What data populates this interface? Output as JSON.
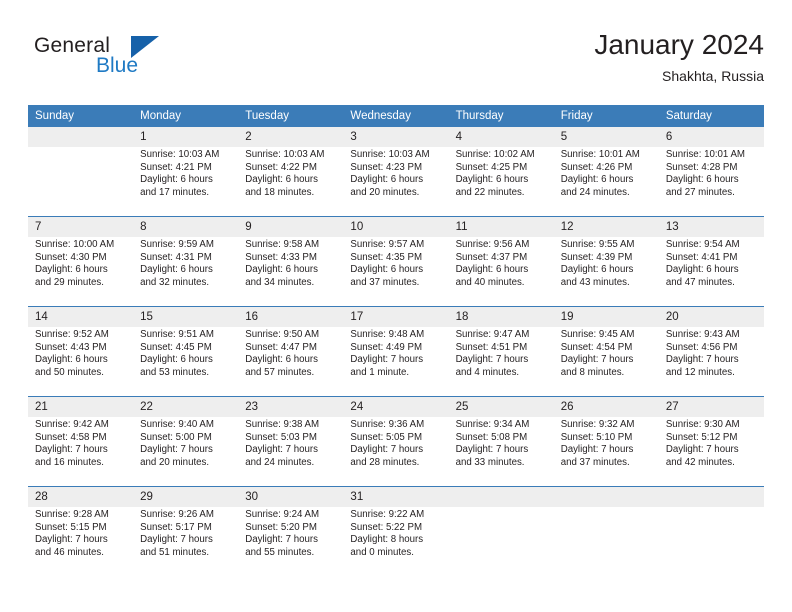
{
  "logo": {
    "word_top": "General",
    "word_bottom": "Blue",
    "triangle_color": "#1661a9",
    "blue_color": "#1f7ac4"
  },
  "header": {
    "title": "January 2024",
    "subtitle": "Shakhta, Russia",
    "header_bg": "#3b7cb8",
    "daynum_bg": "#eeeeee"
  },
  "weekday_headers": [
    "Sunday",
    "Monday",
    "Tuesday",
    "Wednesday",
    "Thursday",
    "Friday",
    "Saturday"
  ],
  "labels": {
    "sunrise": "Sunrise:",
    "sunset": "Sunset:",
    "daylight": "Daylight:"
  },
  "weeks": [
    [
      {
        "day": "",
        "sunrise": "",
        "sunset": "",
        "daylight1": "",
        "daylight2": ""
      },
      {
        "day": "1",
        "sunrise": "Sunrise: 10:03 AM",
        "sunset": "Sunset: 4:21 PM",
        "daylight1": "Daylight: 6 hours",
        "daylight2": "and 17 minutes."
      },
      {
        "day": "2",
        "sunrise": "Sunrise: 10:03 AM",
        "sunset": "Sunset: 4:22 PM",
        "daylight1": "Daylight: 6 hours",
        "daylight2": "and 18 minutes."
      },
      {
        "day": "3",
        "sunrise": "Sunrise: 10:03 AM",
        "sunset": "Sunset: 4:23 PM",
        "daylight1": "Daylight: 6 hours",
        "daylight2": "and 20 minutes."
      },
      {
        "day": "4",
        "sunrise": "Sunrise: 10:02 AM",
        "sunset": "Sunset: 4:25 PM",
        "daylight1": "Daylight: 6 hours",
        "daylight2": "and 22 minutes."
      },
      {
        "day": "5",
        "sunrise": "Sunrise: 10:01 AM",
        "sunset": "Sunset: 4:26 PM",
        "daylight1": "Daylight: 6 hours",
        "daylight2": "and 24 minutes."
      },
      {
        "day": "6",
        "sunrise": "Sunrise: 10:01 AM",
        "sunset": "Sunset: 4:28 PM",
        "daylight1": "Daylight: 6 hours",
        "daylight2": "and 27 minutes."
      }
    ],
    [
      {
        "day": "7",
        "sunrise": "Sunrise: 10:00 AM",
        "sunset": "Sunset: 4:30 PM",
        "daylight1": "Daylight: 6 hours",
        "daylight2": "and 29 minutes."
      },
      {
        "day": "8",
        "sunrise": "Sunrise: 9:59 AM",
        "sunset": "Sunset: 4:31 PM",
        "daylight1": "Daylight: 6 hours",
        "daylight2": "and 32 minutes."
      },
      {
        "day": "9",
        "sunrise": "Sunrise: 9:58 AM",
        "sunset": "Sunset: 4:33 PM",
        "daylight1": "Daylight: 6 hours",
        "daylight2": "and 34 minutes."
      },
      {
        "day": "10",
        "sunrise": "Sunrise: 9:57 AM",
        "sunset": "Sunset: 4:35 PM",
        "daylight1": "Daylight: 6 hours",
        "daylight2": "and 37 minutes."
      },
      {
        "day": "11",
        "sunrise": "Sunrise: 9:56 AM",
        "sunset": "Sunset: 4:37 PM",
        "daylight1": "Daylight: 6 hours",
        "daylight2": "and 40 minutes."
      },
      {
        "day": "12",
        "sunrise": "Sunrise: 9:55 AM",
        "sunset": "Sunset: 4:39 PM",
        "daylight1": "Daylight: 6 hours",
        "daylight2": "and 43 minutes."
      },
      {
        "day": "13",
        "sunrise": "Sunrise: 9:54 AM",
        "sunset": "Sunset: 4:41 PM",
        "daylight1": "Daylight: 6 hours",
        "daylight2": "and 47 minutes."
      }
    ],
    [
      {
        "day": "14",
        "sunrise": "Sunrise: 9:52 AM",
        "sunset": "Sunset: 4:43 PM",
        "daylight1": "Daylight: 6 hours",
        "daylight2": "and 50 minutes."
      },
      {
        "day": "15",
        "sunrise": "Sunrise: 9:51 AM",
        "sunset": "Sunset: 4:45 PM",
        "daylight1": "Daylight: 6 hours",
        "daylight2": "and 53 minutes."
      },
      {
        "day": "16",
        "sunrise": "Sunrise: 9:50 AM",
        "sunset": "Sunset: 4:47 PM",
        "daylight1": "Daylight: 6 hours",
        "daylight2": "and 57 minutes."
      },
      {
        "day": "17",
        "sunrise": "Sunrise: 9:48 AM",
        "sunset": "Sunset: 4:49 PM",
        "daylight1": "Daylight: 7 hours",
        "daylight2": "and 1 minute."
      },
      {
        "day": "18",
        "sunrise": "Sunrise: 9:47 AM",
        "sunset": "Sunset: 4:51 PM",
        "daylight1": "Daylight: 7 hours",
        "daylight2": "and 4 minutes."
      },
      {
        "day": "19",
        "sunrise": "Sunrise: 9:45 AM",
        "sunset": "Sunset: 4:54 PM",
        "daylight1": "Daylight: 7 hours",
        "daylight2": "and 8 minutes."
      },
      {
        "day": "20",
        "sunrise": "Sunrise: 9:43 AM",
        "sunset": "Sunset: 4:56 PM",
        "daylight1": "Daylight: 7 hours",
        "daylight2": "and 12 minutes."
      }
    ],
    [
      {
        "day": "21",
        "sunrise": "Sunrise: 9:42 AM",
        "sunset": "Sunset: 4:58 PM",
        "daylight1": "Daylight: 7 hours",
        "daylight2": "and 16 minutes."
      },
      {
        "day": "22",
        "sunrise": "Sunrise: 9:40 AM",
        "sunset": "Sunset: 5:00 PM",
        "daylight1": "Daylight: 7 hours",
        "daylight2": "and 20 minutes."
      },
      {
        "day": "23",
        "sunrise": "Sunrise: 9:38 AM",
        "sunset": "Sunset: 5:03 PM",
        "daylight1": "Daylight: 7 hours",
        "daylight2": "and 24 minutes."
      },
      {
        "day": "24",
        "sunrise": "Sunrise: 9:36 AM",
        "sunset": "Sunset: 5:05 PM",
        "daylight1": "Daylight: 7 hours",
        "daylight2": "and 28 minutes."
      },
      {
        "day": "25",
        "sunrise": "Sunrise: 9:34 AM",
        "sunset": "Sunset: 5:08 PM",
        "daylight1": "Daylight: 7 hours",
        "daylight2": "and 33 minutes."
      },
      {
        "day": "26",
        "sunrise": "Sunrise: 9:32 AM",
        "sunset": "Sunset: 5:10 PM",
        "daylight1": "Daylight: 7 hours",
        "daylight2": "and 37 minutes."
      },
      {
        "day": "27",
        "sunrise": "Sunrise: 9:30 AM",
        "sunset": "Sunset: 5:12 PM",
        "daylight1": "Daylight: 7 hours",
        "daylight2": "and 42 minutes."
      }
    ],
    [
      {
        "day": "28",
        "sunrise": "Sunrise: 9:28 AM",
        "sunset": "Sunset: 5:15 PM",
        "daylight1": "Daylight: 7 hours",
        "daylight2": "and 46 minutes."
      },
      {
        "day": "29",
        "sunrise": "Sunrise: 9:26 AM",
        "sunset": "Sunset: 5:17 PM",
        "daylight1": "Daylight: 7 hours",
        "daylight2": "and 51 minutes."
      },
      {
        "day": "30",
        "sunrise": "Sunrise: 9:24 AM",
        "sunset": "Sunset: 5:20 PM",
        "daylight1": "Daylight: 7 hours",
        "daylight2": "and 55 minutes."
      },
      {
        "day": "31",
        "sunrise": "Sunrise: 9:22 AM",
        "sunset": "Sunset: 5:22 PM",
        "daylight1": "Daylight: 8 hours",
        "daylight2": "and 0 minutes."
      },
      {
        "day": "",
        "sunrise": "",
        "sunset": "",
        "daylight1": "",
        "daylight2": ""
      },
      {
        "day": "",
        "sunrise": "",
        "sunset": "",
        "daylight1": "",
        "daylight2": ""
      },
      {
        "day": "",
        "sunrise": "",
        "sunset": "",
        "daylight1": "",
        "daylight2": ""
      }
    ]
  ]
}
